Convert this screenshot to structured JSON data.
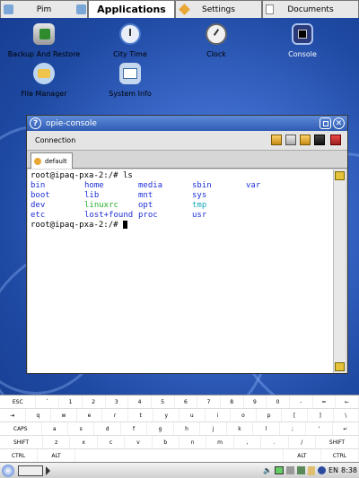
{
  "tabs": [
    {
      "label": "Pim",
      "icon": "pim-icon"
    },
    {
      "label": "Applications",
      "icon": "applications-icon",
      "active": true
    },
    {
      "label": "Settings",
      "icon": "settings-icon"
    },
    {
      "label": "Documents",
      "icon": "documents-icon"
    }
  ],
  "apps": [
    {
      "label": "Backup And Restore",
      "icon": "backup-restore-icon"
    },
    {
      "label": "City Time",
      "icon": "city-time-icon"
    },
    {
      "label": "Clock",
      "icon": "clock-icon"
    },
    {
      "label": "Console",
      "icon": "console-icon",
      "selected": true
    },
    {
      "label": "File Manager",
      "icon": "file-manager-icon"
    },
    {
      "label": "System Info",
      "icon": "system-info-icon"
    }
  ],
  "window": {
    "title": "opie-console",
    "help": "?",
    "menu": "Connection",
    "tab": "default"
  },
  "terminal": {
    "prompt1": "root@ipaq-pxa-2:/# ls",
    "listing": [
      [
        "bin",
        "home",
        "media",
        "sbin",
        "var"
      ],
      [
        "boot",
        "lib",
        "mnt",
        "sys",
        ""
      ],
      [
        "dev",
        "linuxrc",
        "opt",
        "tmp",
        ""
      ],
      [
        "etc",
        "lost+found",
        "proc",
        "usr",
        ""
      ]
    ],
    "prompt2": "root@ipaq-pxa-2:/# ",
    "colors": {
      "dir": "#1c2fd6",
      "link": "#22b02a",
      "tmp": "#16a9b6",
      "text": "#000000"
    }
  },
  "keyboard": {
    "rows": [
      [
        "ESC",
        "`",
        "1",
        "2",
        "3",
        "4",
        "5",
        "6",
        "7",
        "8",
        "9",
        "0",
        "-",
        "=",
        "←"
      ],
      [
        "⇥",
        "q",
        "w",
        "e",
        "r",
        "t",
        "y",
        "u",
        "i",
        "o",
        "p",
        "[",
        "]",
        "\\"
      ],
      [
        "CAPS",
        "a",
        "s",
        "d",
        "f",
        "g",
        "h",
        "j",
        "k",
        "l",
        ";",
        "'",
        "↵"
      ],
      [
        "SHIFT",
        "z",
        "x",
        "c",
        "v",
        "b",
        "n",
        "m",
        ",",
        ".",
        "/",
        "SHIFT"
      ],
      [
        "CTRL",
        "ALT",
        "",
        "ALT",
        "CTRL"
      ]
    ]
  },
  "taskbar": {
    "lang": "EN",
    "time": "8:38"
  }
}
